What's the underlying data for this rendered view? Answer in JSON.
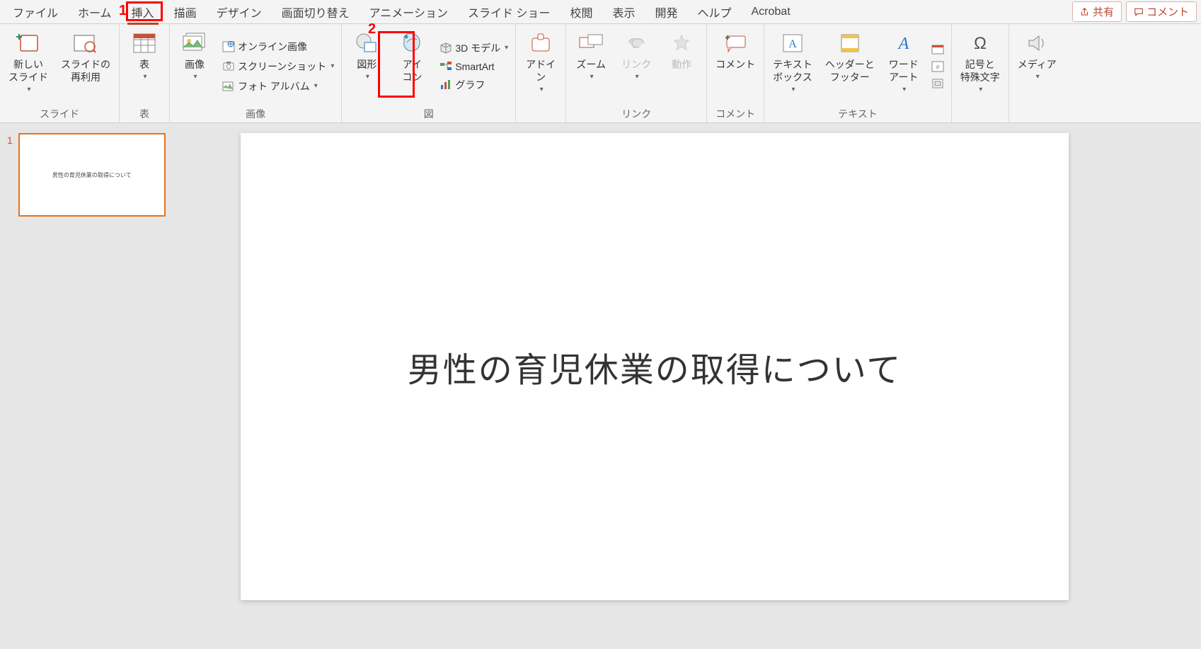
{
  "tabs": {
    "file": "ファイル",
    "home": "ホーム",
    "insert": "挿入",
    "draw": "描画",
    "design": "デザイン",
    "transitions": "画面切り替え",
    "animations": "アニメーション",
    "slideshow": "スライド ショー",
    "review": "校閲",
    "view": "表示",
    "developer": "開発",
    "help": "ヘルプ",
    "acrobat": "Acrobat"
  },
  "topright": {
    "share": "共有",
    "comment": "コメント"
  },
  "ribbon": {
    "slides": {
      "new_slide": "新しい\nスライド",
      "reuse": "スライドの\n再利用",
      "group": "スライド"
    },
    "tables": {
      "table": "表",
      "group": "表"
    },
    "images": {
      "pictures": "画像",
      "online": "オンライン画像",
      "screenshot": "スクリーンショット",
      "album": "フォト アルバム",
      "group": "画像"
    },
    "illus": {
      "shapes": "図形",
      "icons": "アイ\nコン",
      "model3d": "3D モデル",
      "smartart": "SmartArt",
      "chart": "グラフ",
      "group": "図"
    },
    "addins": {
      "addins": "アドイ\nン",
      "group": ""
    },
    "links": {
      "zoom": "ズーム",
      "link": "リンク",
      "action": "動作",
      "group": "リンク"
    },
    "comments": {
      "comment": "コメント",
      "group": "コメント"
    },
    "text": {
      "textbox": "テキスト\nボックス",
      "headerfooter": "ヘッダーと\nフッター",
      "wordart": "ワード\nアート",
      "group": "テキスト"
    },
    "symbols": {
      "symbols": "記号と\n特殊文字",
      "group": ""
    },
    "media": {
      "media": "メディア",
      "group": ""
    }
  },
  "callouts": {
    "one": "1",
    "two": "2"
  },
  "thumbs": {
    "num1": "1"
  },
  "slide": {
    "title": "男性の育児休業の取得について"
  }
}
